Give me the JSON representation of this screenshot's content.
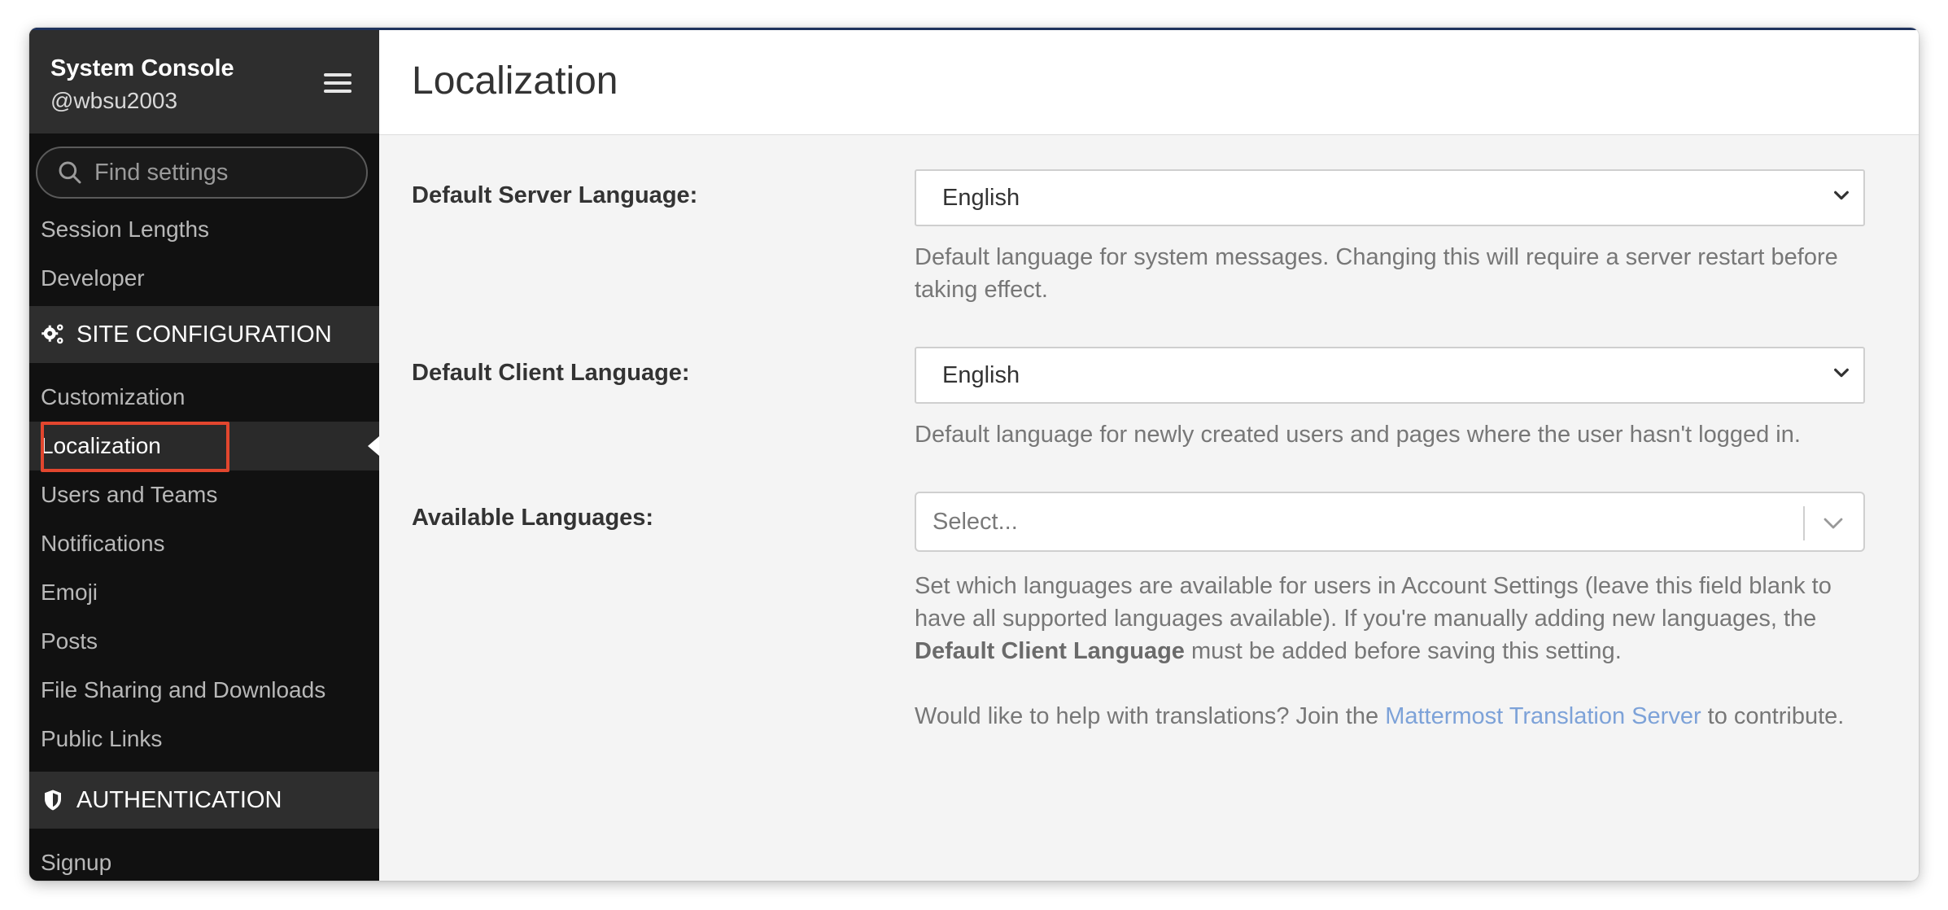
{
  "sidebar": {
    "title": "System Console",
    "username": "@wbsu2003",
    "search_placeholder": "Find settings",
    "items_top": [
      "Session Lengths",
      "Developer"
    ],
    "site_configuration": {
      "label": "SITE CONFIGURATION",
      "items": [
        "Customization",
        "Localization",
        "Users and Teams",
        "Notifications",
        "Emoji",
        "Posts",
        "File Sharing and Downloads",
        "Public Links"
      ]
    },
    "authentication": {
      "label": "AUTHENTICATION",
      "items": [
        "Signup"
      ]
    }
  },
  "main": {
    "title": "Localization",
    "default_server_language": {
      "label": "Default Server Language:",
      "value": "English",
      "help": "Default language for system messages. Changing this will require a server restart before taking effect."
    },
    "default_client_language": {
      "label": "Default Client Language:",
      "value": "English",
      "help": "Default language for newly created users and pages where the user hasn't logged in."
    },
    "available_languages": {
      "label": "Available Languages:",
      "placeholder": "Select...",
      "help_part1": "Set which languages are available for users in Account Settings (leave this field blank to have all supported languages available). If you're manually adding new languages, the ",
      "help_bold": "Default Client Language",
      "help_part2": " must be added before saving this setting.",
      "translate_part1": "Would like to help with translations? Join the ",
      "translate_link": "Mattermost Translation Server",
      "translate_part2": " to contribute."
    }
  },
  "colors": {
    "highlight": "#e2462e",
    "link": "#7da2d8",
    "sidebar_bg": "#111111"
  }
}
